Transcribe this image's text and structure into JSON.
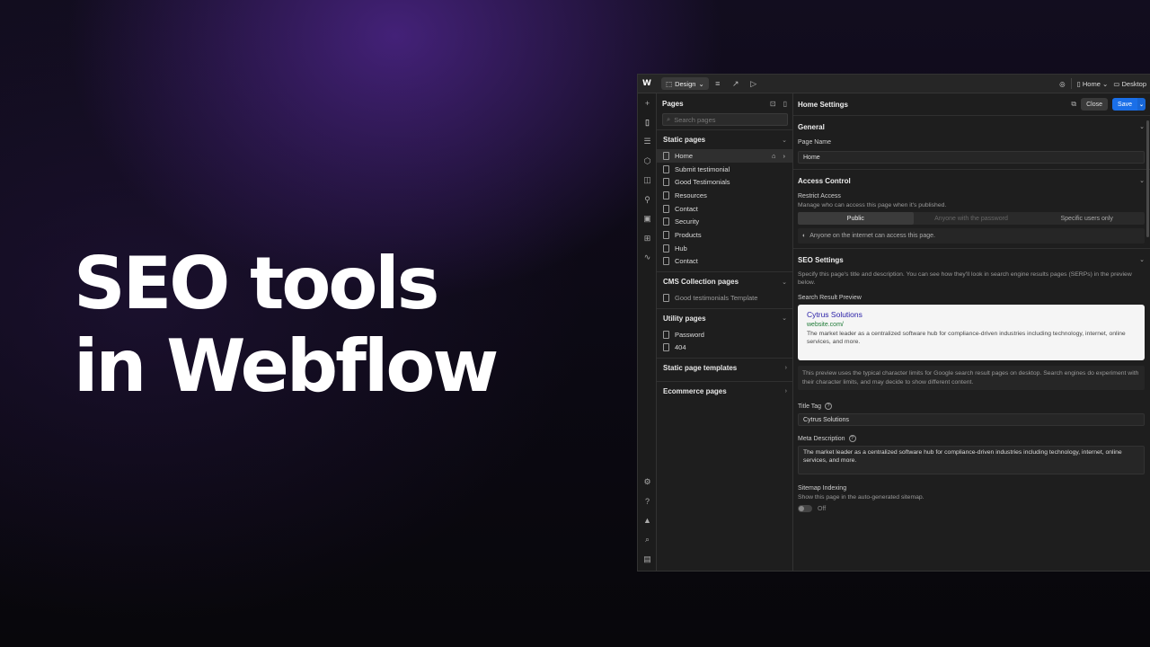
{
  "hero": {
    "line1": "SEO tools",
    "line2": "in Webflow"
  },
  "topbar": {
    "logo": "W",
    "mode_label": "Design",
    "page_selector": "Home",
    "breakpoint": "Desktop"
  },
  "pages_panel": {
    "title": "Pages",
    "search_placeholder": "Search pages",
    "static_pages": {
      "title": "Static pages",
      "items": [
        "Home",
        "Submit testimonial",
        "Good Testimonials",
        "Resources",
        "Contact",
        "Security",
        "Products",
        "Hub",
        "Contact"
      ]
    },
    "cms_pages": {
      "title": "CMS Collection pages",
      "items": [
        "Good testimonials Template"
      ]
    },
    "utility_pages": {
      "title": "Utility pages",
      "items": [
        "Password",
        "404"
      ]
    },
    "templates": {
      "title": "Static page templates"
    },
    "ecommerce": {
      "title": "Ecommerce pages"
    }
  },
  "settings": {
    "title": "Home Settings",
    "close_label": "Close",
    "save_label": "Save",
    "general": {
      "title": "General",
      "page_name_label": "Page Name",
      "page_name_value": "Home"
    },
    "access": {
      "title": "Access Control",
      "restrict_label": "Restrict Access",
      "restrict_desc": "Manage who can access this page when it's published.",
      "options": [
        "Public",
        "Anyone with the password",
        "Specific users only"
      ],
      "note": "Anyone on the internet can access this page."
    },
    "seo": {
      "title": "SEO Settings",
      "desc": "Specify this page's title and description. You can see how they'll look in search engine results pages (SERPs) in the preview below.",
      "preview_label": "Search Result Preview",
      "preview_title": "Cytrus Solutions",
      "preview_url": "website.com/",
      "preview_desc": "The market leader as a centralized software hub for compliance-driven industries including technology, internet, online services, and more.",
      "info": "This preview uses the typical character limits for Google search result pages on desktop. Search engines do experiment with their character limits, and may decide to show different content.",
      "title_tag_label": "Title Tag",
      "title_tag_value": "Cytrus Solutions",
      "meta_label": "Meta Description",
      "meta_value": "The market leader as a centralized software hub for compliance-driven industries including technology, internet, online services, and more.",
      "sitemap_label": "Sitemap Indexing",
      "sitemap_desc": "Show this page in the auto-generated sitemap.",
      "sitemap_state": "Off"
    }
  },
  "colors": {
    "accent": "#1a6fe8",
    "warning": "#f3c33a",
    "preview_title": "#2b21a8",
    "preview_url": "#1e7a36"
  }
}
